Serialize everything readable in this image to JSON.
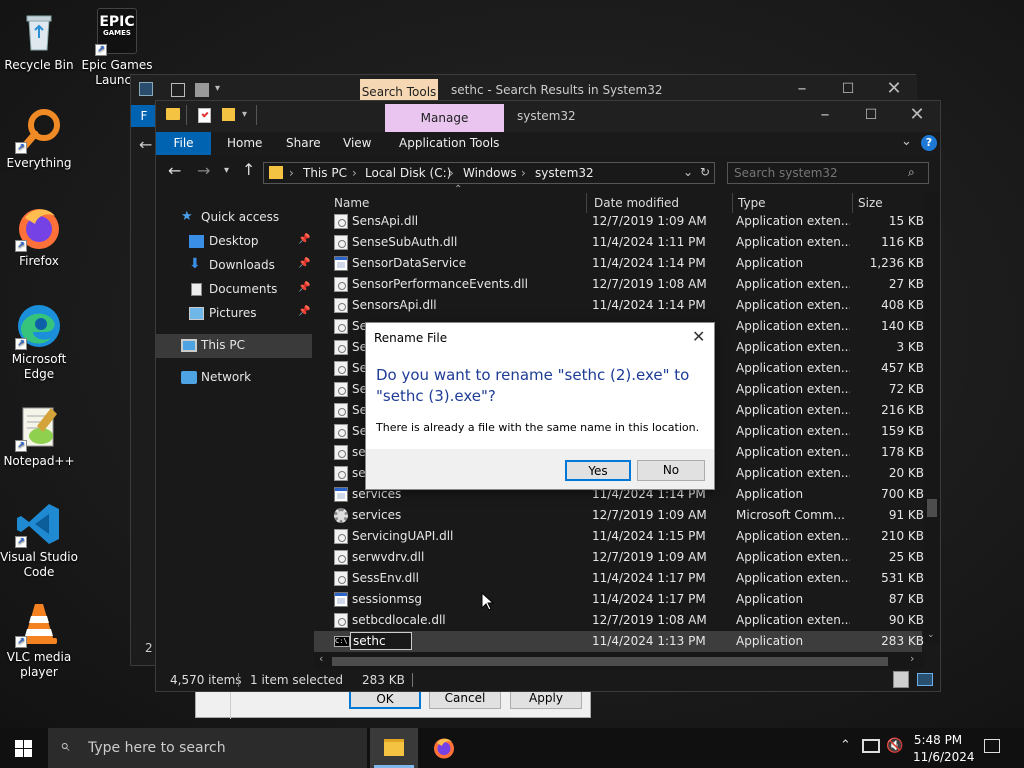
{
  "desktop_icons": [
    {
      "label": "Recycle Bin",
      "icon": "recycle-bin-icon"
    },
    {
      "label": "Epic Games Launch",
      "icon": "epic-games-icon",
      "logo_text": "EPIC GAMES"
    },
    {
      "label": "Everything",
      "icon": "everything-search-icon"
    },
    {
      "label": "Firefox",
      "icon": "firefox-icon"
    },
    {
      "label": "Microsoft Edge",
      "icon": "edge-icon"
    },
    {
      "label": "Notepad++",
      "icon": "notepadpp-icon"
    },
    {
      "label": "Visual Studio Code",
      "icon": "vscode-icon"
    },
    {
      "label": "VLC media player",
      "icon": "vlc-icon"
    }
  ],
  "back_window": {
    "contextual_tab": "Search Tools",
    "title": "sethc - Search Results in System32",
    "ribbon_letter": "F"
  },
  "properties_dialog": {
    "ok": "OK",
    "cancel": "Cancel",
    "apply": "Apply"
  },
  "explorer": {
    "contextual_tab": "Manage",
    "title": "system32",
    "ribbon_tabs": [
      "File",
      "Home",
      "Share",
      "View",
      "Application Tools"
    ],
    "address": [
      "This PC",
      "Local Disk (C:)",
      "Windows",
      "system32"
    ],
    "search_placeholder": "Search system32",
    "columns": [
      "Name",
      "Date modified",
      "Type",
      "Size"
    ],
    "nav": {
      "quick_access": "Quick access",
      "items": [
        "Desktop",
        "Downloads",
        "Documents",
        "Pictures"
      ],
      "this_pc": "This PC",
      "network": "Network"
    },
    "rows": [
      {
        "name": "SensApi.dll",
        "date": "12/7/2019 1:09 AM",
        "type": "Application exten...",
        "size": "15 KB",
        "icon": "dll"
      },
      {
        "name": "SenseSubAuth.dll",
        "date": "11/4/2024 1:11 PM",
        "type": "Application exten...",
        "size": "116 KB",
        "icon": "dll"
      },
      {
        "name": "SensorDataService",
        "date": "11/4/2024 1:14 PM",
        "type": "Application",
        "size": "1,236 KB",
        "icon": "app"
      },
      {
        "name": "SensorPerformanceEvents.dll",
        "date": "12/7/2019 1:08 AM",
        "type": "Application exten...",
        "size": "27 KB",
        "icon": "dll"
      },
      {
        "name": "SensorsApi.dll",
        "date": "11/4/2024 1:14 PM",
        "type": "Application exten...",
        "size": "408 KB",
        "icon": "dll"
      },
      {
        "name": "Se",
        "date": "",
        "type": "Application exten...",
        "size": "140 KB",
        "icon": "dll"
      },
      {
        "name": "Se",
        "date": "",
        "type": "Application exten...",
        "size": "3 KB",
        "icon": "dll"
      },
      {
        "name": "Se",
        "date": "",
        "type": "Application exten...",
        "size": "457 KB",
        "icon": "dll"
      },
      {
        "name": "Se",
        "date": "",
        "type": "Application exten...",
        "size": "72 KB",
        "icon": "dll"
      },
      {
        "name": "Se",
        "date": "",
        "type": "Application exten...",
        "size": "216 KB",
        "icon": "dll"
      },
      {
        "name": "Se",
        "date": "",
        "type": "Application exten...",
        "size": "159 KB",
        "icon": "dll"
      },
      {
        "name": "se",
        "date": "",
        "type": "Application exten...",
        "size": "178 KB",
        "icon": "dll"
      },
      {
        "name": "se",
        "date": "",
        "type": "Application exten...",
        "size": "20 KB",
        "icon": "dll"
      },
      {
        "name": "services",
        "date": "11/4/2024 1:14 PM",
        "type": "Application",
        "size": "700 KB",
        "icon": "app"
      },
      {
        "name": "services",
        "date": "12/7/2019 1:09 AM",
        "type": "Microsoft Comm...",
        "size": "91 KB",
        "icon": "gear"
      },
      {
        "name": "ServicingUAPI.dll",
        "date": "11/4/2024 1:15 PM",
        "type": "Application exten...",
        "size": "210 KB",
        "icon": "dll"
      },
      {
        "name": "serwvdrv.dll",
        "date": "12/7/2019 1:09 AM",
        "type": "Application exten...",
        "size": "25 KB",
        "icon": "dll"
      },
      {
        "name": "SessEnv.dll",
        "date": "11/4/2024 1:17 PM",
        "type": "Application exten...",
        "size": "531 KB",
        "icon": "dll"
      },
      {
        "name": "sessionmsg",
        "date": "11/4/2024 1:17 PM",
        "type": "Application",
        "size": "87 KB",
        "icon": "app"
      },
      {
        "name": "setbcdlocale.dll",
        "date": "12/7/2019 1:08 AM",
        "type": "Application exten...",
        "size": "90 KB",
        "icon": "dll"
      },
      {
        "name": "sethc",
        "date": "11/4/2024 1:13 PM",
        "type": "Application",
        "size": "283 KB",
        "icon": "cmd",
        "selected": true
      }
    ],
    "status": {
      "items": "4,570 items",
      "selected": "1 item selected",
      "size": "283 KB"
    }
  },
  "rename_dialog": {
    "title": "Rename File",
    "question": "Do you want to rename \"sethc (2).exe\" to \"sethc (3).exe\"?",
    "detail": "There is already a file with the same name in this location.",
    "yes": "Yes",
    "no": "No"
  },
  "taskbar": {
    "search_placeholder": "Type here to search",
    "time": "5:48 PM",
    "date": "11/6/2024"
  },
  "colors": {
    "accent": "#0063b1",
    "dialog_heading": "#1e3c96",
    "manage_tab": "#e9c5f0",
    "search_tools_tab": "#f6d7b3"
  }
}
